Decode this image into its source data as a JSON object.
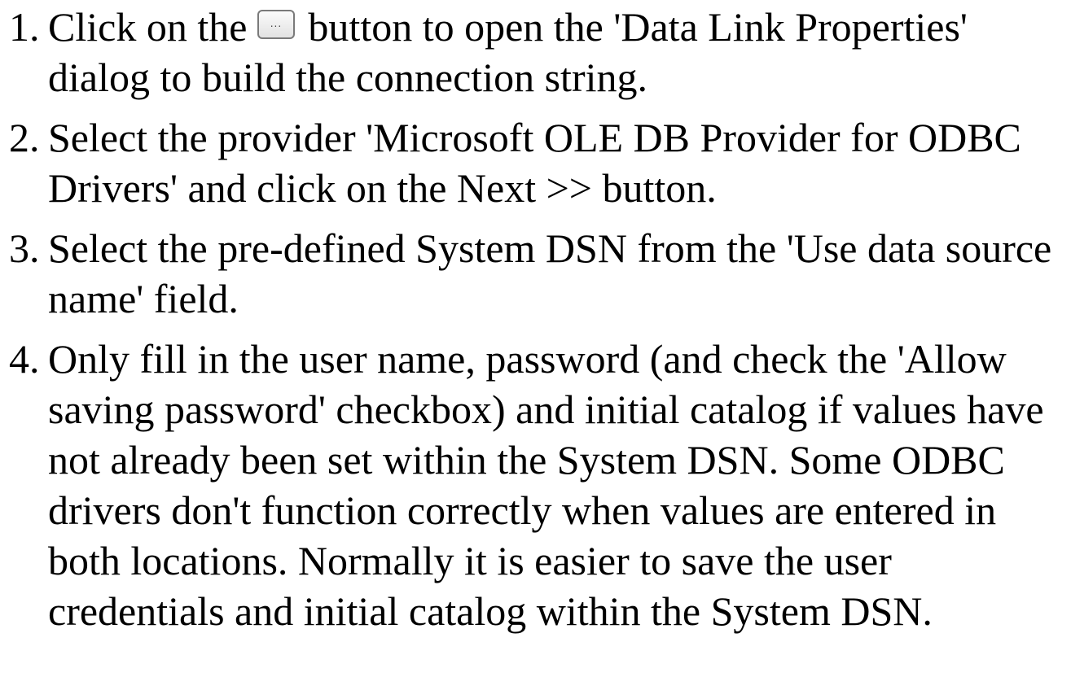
{
  "steps": [
    {
      "number": "1.",
      "text_before_button": "Click on the",
      "button_label": "...",
      "text_after_button": "button to open the 'Data Link Properties' dialog to build the connection string."
    },
    {
      "number": "2.",
      "text": "Select the provider 'Microsoft OLE DB Provider for ODBC Drivers' and click on the Next >> button."
    },
    {
      "number": "3.",
      "text": "Select the pre-defined System DSN from the 'Use data source name' field."
    },
    {
      "number": "4.",
      "text": "Only fill in the user name, password (and check the 'Allow saving password' checkbox) and initial catalog if values have not already been set within the System DSN.  Some ODBC drivers don't function correctly when values are entered in both locations.  Normally it is easier to save the user credentials and initial catalog within the System DSN."
    }
  ]
}
